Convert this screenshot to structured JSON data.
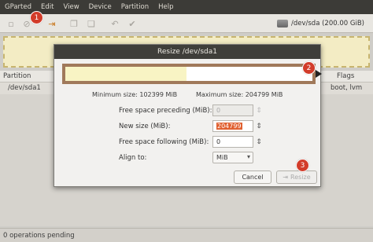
{
  "menubar": {
    "items": [
      "GParted",
      "Edit",
      "View",
      "Device",
      "Partition",
      "Help"
    ]
  },
  "toolbar": {
    "device": "/dev/sda  (200.00 GiB)"
  },
  "partition_list": {
    "headers": {
      "partition": "Partition",
      "flags": "Flags"
    },
    "rows": [
      {
        "partition": "/dev/sda1",
        "flags": "boot, lvm"
      }
    ]
  },
  "status": {
    "text": "0 operations pending"
  },
  "badges": {
    "one": "1",
    "two": "2",
    "three": "3"
  },
  "dialog": {
    "title": "Resize /dev/sda1",
    "min_size": "Minimum size: 102399 MiB",
    "max_size": "Maximum size: 204799 MiB",
    "fields": {
      "free_preceding_label": "Free space preceding (MiB):",
      "free_preceding_value": "0",
      "new_size_label": "New size (MiB):",
      "new_size_value": "204799",
      "free_following_label": "Free space following (MiB):",
      "free_following_value": "0",
      "align_label": "Align to:",
      "align_value": "MiB"
    },
    "buttons": {
      "cancel": "Cancel",
      "resize": "Resize"
    }
  },
  "colors": {
    "accent": "#e06030",
    "badge": "#d23c2a",
    "title_bar": "#3f3e3a"
  }
}
